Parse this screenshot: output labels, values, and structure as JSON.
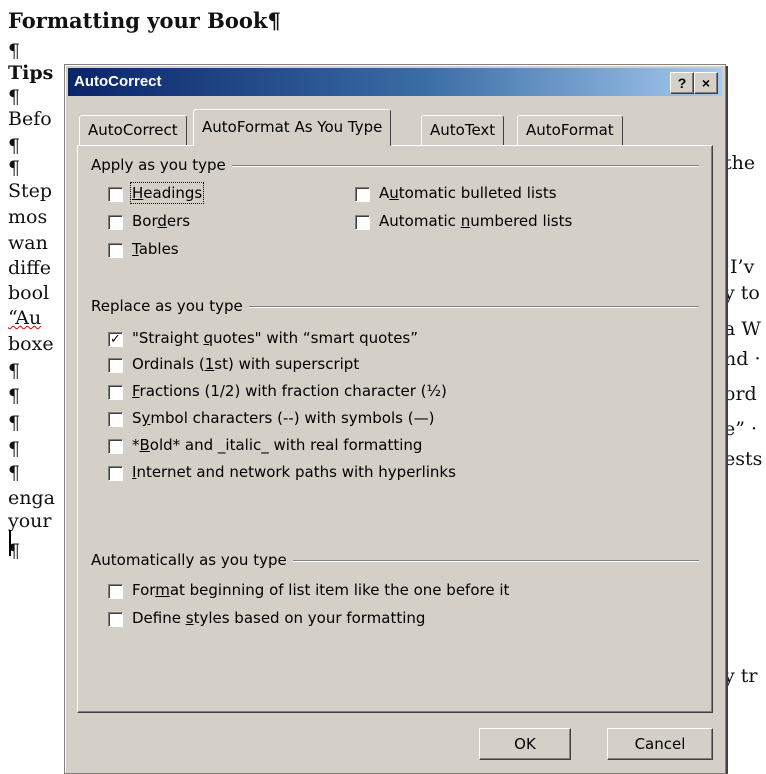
{
  "document": {
    "title": "Formatting your Book¶",
    "left_lines": [
      "¶",
      "Tips",
      "¶",
      "Befo",
      "¶",
      "¶",
      "Step",
      "mos",
      "wan",
      "diffe",
      "bool",
      "“Au",
      "boxe",
      "¶",
      "¶",
      "¶",
      "¶",
      "¶",
      "enga",
      "your",
      "¶"
    ],
    "right_lines": [
      "the",
      "·I’v",
      "y to",
      "a W",
      "nd ·",
      "ord",
      "e” ·",
      "ests",
      "y tr"
    ]
  },
  "dialog": {
    "title": "AutoCorrect",
    "help_button": "?",
    "close_button": "×",
    "tabs": [
      "AutoCorrect",
      "AutoFormat As You Type",
      "AutoText",
      "AutoFormat"
    ],
    "active_tab": "AutoFormat As You Type",
    "apply_group": {
      "label": "Apply as you type",
      "items": [
        {
          "pre": "",
          "key": "H",
          "post": "eadings",
          "checked": false
        },
        {
          "pre": "Bor",
          "key": "d",
          "post": "ers",
          "checked": false
        },
        {
          "pre": "",
          "key": "T",
          "post": "ables",
          "checked": false
        },
        {
          "pre": "A",
          "key": "u",
          "post": "tomatic bulleted lists",
          "checked": false
        },
        {
          "pre": "Automatic ",
          "key": "n",
          "post": "umbered lists",
          "checked": false
        }
      ]
    },
    "replace_group": {
      "label": "Replace as you type",
      "items": [
        {
          "pre": "\"Straight ",
          "key": "q",
          "post": "uotes\" with “smart quotes”",
          "checked": true
        },
        {
          "pre": "Ordinals (",
          "key": "1",
          "post": "st) with superscript",
          "checked": false
        },
        {
          "pre": "",
          "key": "F",
          "post": "ractions (1/2) with fraction character (½)",
          "checked": false
        },
        {
          "pre": "S",
          "key": "y",
          "post": "mbol characters (--) with symbols (—)",
          "checked": false
        },
        {
          "pre": "*",
          "key": "B",
          "post": "old* and _italic_ with real formatting",
          "checked": false
        },
        {
          "pre": "",
          "key": "I",
          "post": "nternet and network paths with hyperlinks",
          "checked": false
        }
      ]
    },
    "auto_group": {
      "label": "Automatically as you type",
      "items": [
        {
          "pre": "For",
          "key": "m",
          "post": "at beginning of list item like the one before it",
          "checked": false
        },
        {
          "pre": "Define ",
          "key": "s",
          "post": "tyles based on your formatting",
          "checked": false
        }
      ]
    },
    "ok_label": "OK",
    "cancel_label": "Cancel"
  }
}
